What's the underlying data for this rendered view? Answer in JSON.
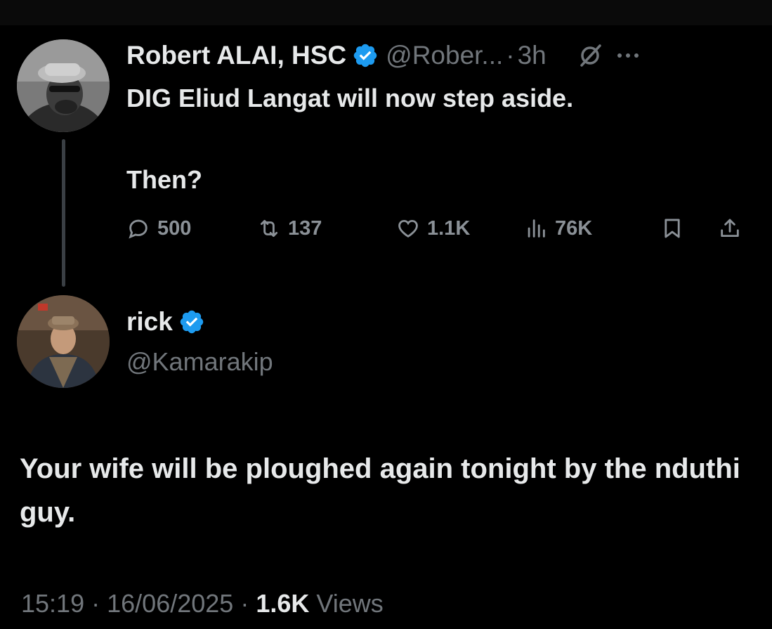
{
  "parent_tweet": {
    "author_name": "Robert ALAI, HSC",
    "handle": "@Rober...",
    "separator": "·",
    "time": "3h",
    "verified": true,
    "text_line1": "DIG Eliud Langat will now step aside.",
    "text_line2": "Then?",
    "stats": {
      "replies": "500",
      "retweets": "137",
      "likes": "1.1K",
      "views": "76K"
    },
    "icons": [
      "reply-icon",
      "retweet-icon",
      "like-icon",
      "views-icon",
      "bookmark-icon",
      "share-icon",
      "grok-icon",
      "more-icon"
    ]
  },
  "reply_tweet": {
    "author_name": "rick",
    "handle": "@Kamarakip",
    "verified": true,
    "text": "Your wife will be ploughed again tonight by the nduthi guy.",
    "meta": {
      "time": "15:19",
      "sep1": "·",
      "date": "16/06/2025",
      "sep2": "·",
      "views_count": "1.6K",
      "views_label": "Views"
    }
  },
  "colors": {
    "background": "#000000",
    "text_primary": "#e7e9ea",
    "text_secondary": "#71767b",
    "verified_blue": "#1d9bf0"
  }
}
